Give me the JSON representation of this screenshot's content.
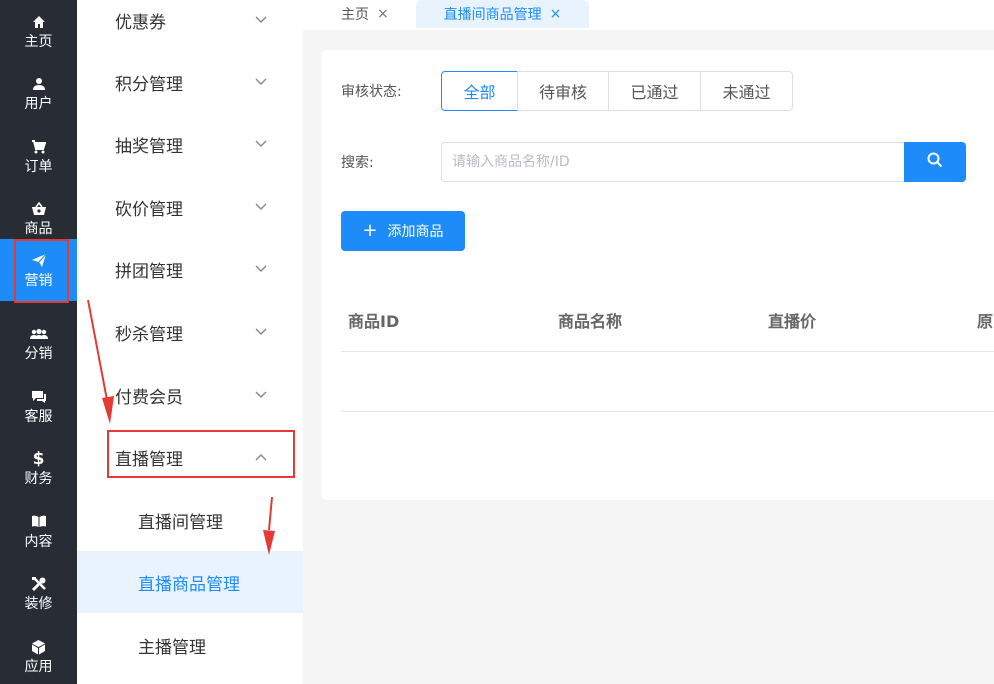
{
  "rail": {
    "items": [
      {
        "label": "主页",
        "icon": "home-icon"
      },
      {
        "label": "用户",
        "icon": "user-icon"
      },
      {
        "label": "订单",
        "icon": "cart-icon"
      },
      {
        "label": "商品",
        "icon": "basket-icon"
      },
      {
        "label": "营销",
        "icon": "paper-plane-icon"
      },
      {
        "label": "分销",
        "icon": "group-icon"
      },
      {
        "label": "客服",
        "icon": "chat-icon"
      },
      {
        "label": "财务",
        "icon": "dollar-icon"
      },
      {
        "label": "内容",
        "icon": "book-icon"
      },
      {
        "label": "装修",
        "icon": "tools-icon"
      },
      {
        "label": "应用",
        "icon": "cube-icon"
      }
    ],
    "active_index": 4
  },
  "submenu": {
    "items": [
      {
        "label": "优惠券"
      },
      {
        "label": "积分管理"
      },
      {
        "label": "抽奖管理"
      },
      {
        "label": "砍价管理"
      },
      {
        "label": "拼团管理"
      },
      {
        "label": "秒杀管理"
      },
      {
        "label": "付费会员"
      },
      {
        "label": "直播管理"
      }
    ],
    "open_index": 7,
    "children": [
      {
        "label": "直播间管理"
      },
      {
        "label": "直播商品管理"
      },
      {
        "label": "主播管理"
      }
    ],
    "active_child_index": 1
  },
  "tabs": [
    {
      "label": "主页",
      "close": "×"
    },
    {
      "label": "直播间商品管理",
      "close": "×"
    }
  ],
  "filter": {
    "status_label": "审核状态:",
    "options": [
      "全部",
      "待审核",
      "已通过",
      "未通过"
    ],
    "selected": "全部",
    "search_label": "搜索:",
    "search_placeholder": "请输入商品名称/ID",
    "search_value": ""
  },
  "toolbar": {
    "add_plus": "+",
    "add_label": "添加商品"
  },
  "table": {
    "columns": [
      "商品ID",
      "商品名称",
      "直播价",
      "原"
    ]
  },
  "colors": {
    "accent": "#1d8cf8",
    "rail_bg": "#282d35",
    "annotation": "#e53935"
  }
}
